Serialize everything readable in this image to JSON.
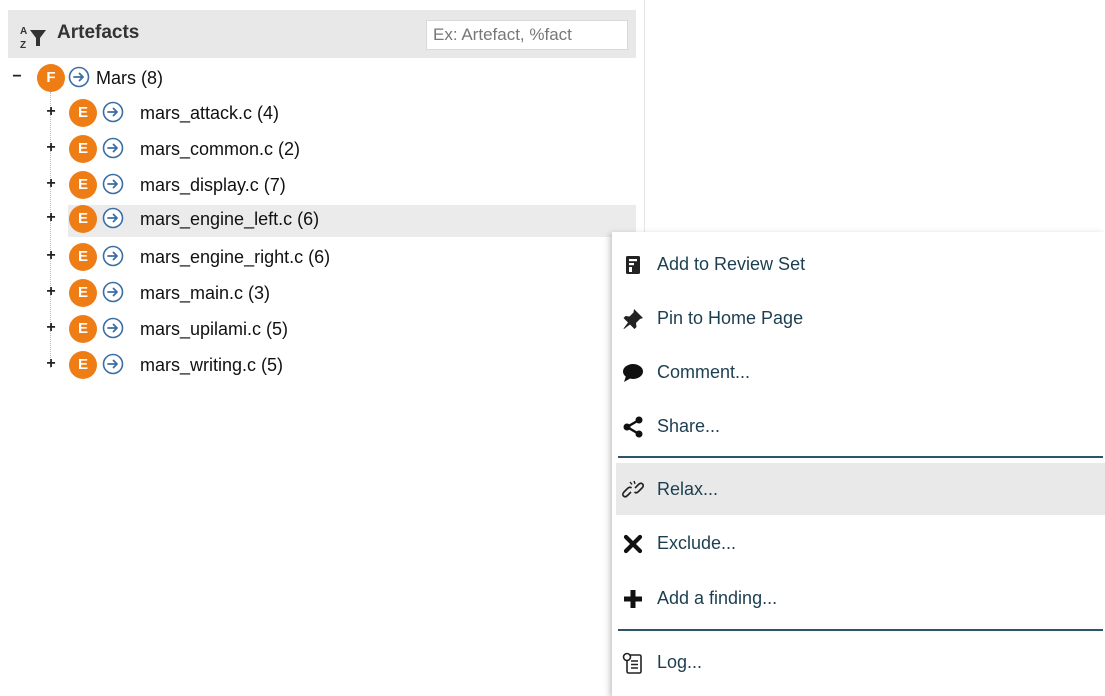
{
  "panel": {
    "title": "Artefacts",
    "search_placeholder": "Ex: Artefact, %fact"
  },
  "tree": {
    "root": {
      "expander": "−",
      "badge": "F",
      "label": "Mars (8)"
    },
    "children": [
      {
        "expander": "+",
        "badge": "E",
        "label": "mars_attack.c (4)"
      },
      {
        "expander": "+",
        "badge": "E",
        "label": "mars_common.c (2)"
      },
      {
        "expander": "+",
        "badge": "E",
        "label": "mars_display.c (7)"
      },
      {
        "expander": "+",
        "badge": "E",
        "label": "mars_engine_left.c (6)",
        "selected": true
      },
      {
        "expander": "+",
        "badge": "E",
        "label": "mars_engine_right.c (6)"
      },
      {
        "expander": "+",
        "badge": "E",
        "label": "mars_main.c (3)"
      },
      {
        "expander": "+",
        "badge": "E",
        "label": "mars_upilami.c (5)"
      },
      {
        "expander": "+",
        "badge": "E",
        "label": "mars_writing.c (5)"
      }
    ]
  },
  "context_menu": {
    "items": [
      {
        "label": "Add to Review Set",
        "icon": "review-set-icon"
      },
      {
        "label": "Pin to Home Page",
        "icon": "pin-icon"
      },
      {
        "label": "Comment...",
        "icon": "comment-icon"
      },
      {
        "label": "Share...",
        "icon": "share-icon"
      },
      {
        "label": "Relax...",
        "icon": "relax-link-icon",
        "highlighted": true
      },
      {
        "label": "Exclude...",
        "icon": "close-icon"
      },
      {
        "label": "Add a finding...",
        "icon": "plus-icon"
      },
      {
        "label": "Log...",
        "icon": "log-icon"
      }
    ]
  },
  "colors": {
    "badge": "#ef7d16",
    "nav_icon": "#3a6ea5",
    "menu_text": "#1b3f50",
    "separator": "#2e5566",
    "header_bg": "#e8e8e8",
    "selected_row": "#ebebeb"
  }
}
